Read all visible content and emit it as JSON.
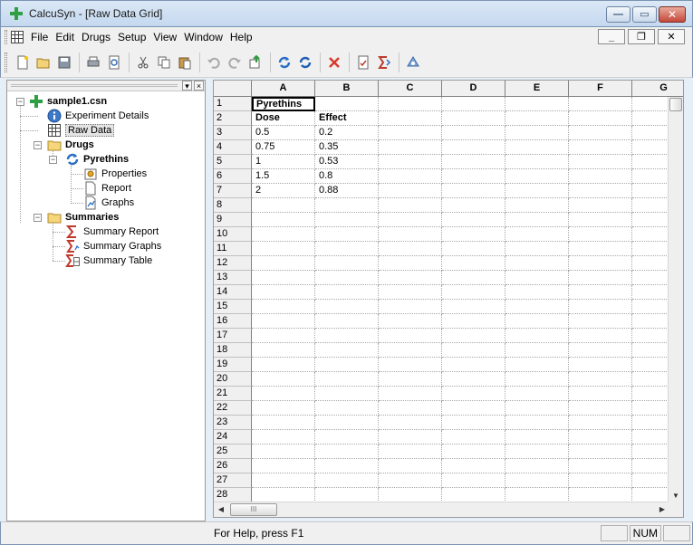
{
  "window": {
    "title": "CalcuSyn - [Raw Data Grid]",
    "minimize_glyph": "—",
    "maximize_glyph": "▭",
    "close_glyph": "✕"
  },
  "menu": {
    "items": [
      "File",
      "Edit",
      "Drugs",
      "Setup",
      "View",
      "Window",
      "Help"
    ],
    "mdi_minimize": "_",
    "mdi_restore": "❐",
    "mdi_close": "✕"
  },
  "toolbar": {
    "buttons": [
      "new-icon",
      "open-icon",
      "save-icon",
      "print-icon",
      "print-preview-icon",
      "cut-icon",
      "copy-icon",
      "paste-icon",
      "undo-icon",
      "redo-icon",
      "export-icon",
      "refresh-icon",
      "recalculate-icon",
      "delete-icon",
      "report-icon",
      "summary-icon",
      "help-icon"
    ]
  },
  "tree": {
    "root": "sample1.csn",
    "experiment_details": "Experiment Details",
    "raw_data": "Raw Data",
    "drugs": "Drugs",
    "drug_name": "Pyrethins",
    "properties": "Properties",
    "report": "Report",
    "graphs": "Graphs",
    "summaries": "Summaries",
    "summary_report": "Summary Report",
    "summary_graphs": "Summary Graphs",
    "summary_table": "Summary Table",
    "header_pin": "▾",
    "header_close": "×"
  },
  "grid": {
    "columns": [
      "A",
      "B",
      "C",
      "D",
      "E",
      "F",
      "G"
    ],
    "rows": [
      [
        "Pyrethins",
        ""
      ],
      [
        "Dose",
        "Effect"
      ],
      [
        "0.5",
        "0.2"
      ],
      [
        "0.75",
        "0.35"
      ],
      [
        "1",
        "0.53"
      ],
      [
        "1.5",
        "0.8"
      ],
      [
        "2",
        "0.88"
      ],
      [
        "",
        ""
      ],
      [
        "",
        ""
      ],
      [
        "",
        ""
      ],
      [
        "",
        ""
      ],
      [
        "",
        ""
      ],
      [
        "",
        ""
      ],
      [
        "",
        ""
      ],
      [
        "",
        ""
      ],
      [
        "",
        ""
      ],
      [
        "",
        ""
      ],
      [
        "",
        ""
      ],
      [
        "",
        ""
      ],
      [
        "",
        ""
      ],
      [
        "",
        ""
      ],
      [
        "",
        ""
      ],
      [
        "",
        ""
      ],
      [
        "",
        ""
      ],
      [
        "",
        ""
      ],
      [
        "",
        ""
      ],
      [
        "",
        ""
      ],
      [
        "",
        ""
      ]
    ],
    "row_numbers": [
      "1",
      "2",
      "3",
      "4",
      "5",
      "6",
      "7",
      "8",
      "9",
      "10",
      "11",
      "12",
      "13",
      "14",
      "15",
      "16",
      "17",
      "18",
      "19",
      "20",
      "21",
      "22",
      "23",
      "24",
      "25",
      "26",
      "27",
      "28"
    ],
    "scroll_thumb_glyph": "III",
    "up_arrow": "▲",
    "down_arrow": "▼",
    "left_arrow": "◀",
    "right_arrow": "▶"
  },
  "status": {
    "help_text": "For Help, press F1",
    "num_indicator": "NUM"
  },
  "colors": {
    "accent": "#2a78c8",
    "selection_border": "#000000"
  }
}
